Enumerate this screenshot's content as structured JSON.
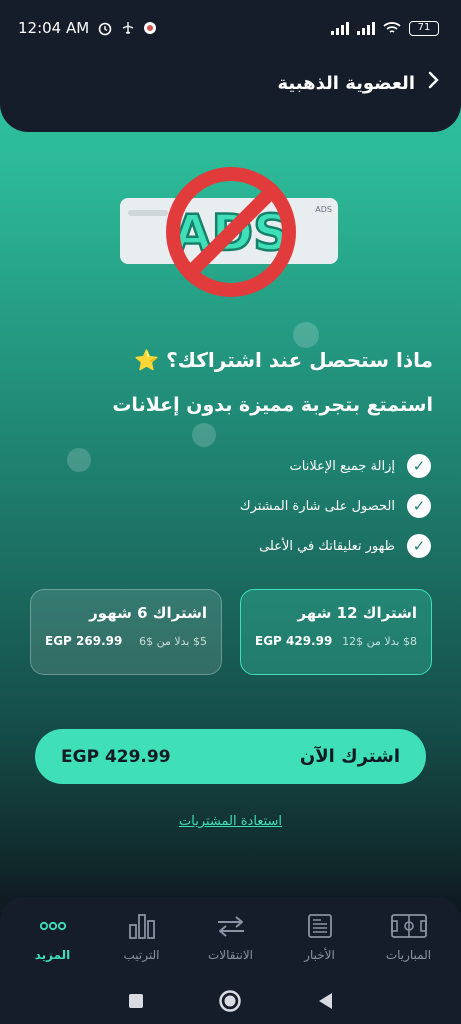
{
  "status_bar": {
    "time": "12:04 AM",
    "battery": "71"
  },
  "header": {
    "title": "العضوية الذهبية",
    "back_icon": "chevron-right-icon"
  },
  "hero": {
    "ads_tag": "ADS",
    "ads_text": "ADS",
    "colors": {
      "no_sign": "#e23b3b",
      "ads_letters": "#3fe0b8"
    }
  },
  "content": {
    "question": "ماذا ستحصل عند اشتراكك؟",
    "question_icon": "⭐",
    "subtitle": "استمتع بتجربة مميزة بدون إعلانات",
    "features": [
      {
        "label": "إزالة جميع الإعلانات"
      },
      {
        "label": "الحصول على شارة المشترك"
      },
      {
        "label": "ظهور تعليقاتك في الأعلى"
      }
    ]
  },
  "plans": [
    {
      "name": "اشتراك 12 شهر",
      "price": "EGP 429.99",
      "monthly": "$8",
      "instead_of": "بدلا من $12",
      "selected": true
    },
    {
      "name": "اشتراك 6 شهور",
      "price": "EGP 269.99",
      "monthly": "$5",
      "instead_of": "بدلا من $6",
      "selected": false
    }
  ],
  "subscribe": {
    "label": "اشترك الآن",
    "price": "EGP 429.99"
  },
  "restore_label": "استعادة المشتريات",
  "bottom_nav": [
    {
      "label": "المزيد",
      "icon": "more-dots-icon",
      "active": true
    },
    {
      "label": "الترتيب",
      "icon": "bar-chart-icon",
      "active": false
    },
    {
      "label": "الانتقالات",
      "icon": "transfer-arrows-icon",
      "active": false
    },
    {
      "label": "الأخبار",
      "icon": "newspaper-icon",
      "active": false
    },
    {
      "label": "المباريات",
      "icon": "pitch-icon",
      "active": false
    }
  ],
  "colors": {
    "accent": "#3fe0b8",
    "dark": "#151c2a"
  }
}
